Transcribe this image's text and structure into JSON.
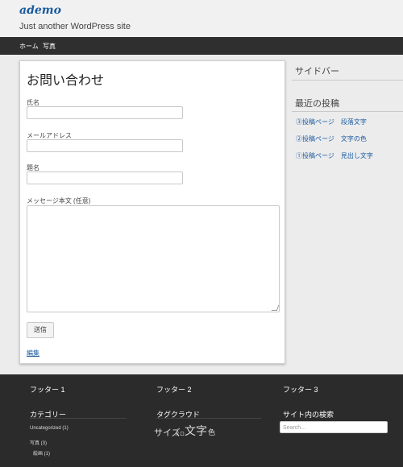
{
  "header": {
    "site_title": "ademo",
    "tagline": "Just another WordPress site"
  },
  "nav": {
    "items": [
      {
        "label": "ホーム"
      },
      {
        "label": "写真"
      }
    ]
  },
  "content": {
    "title": "お問い合わせ",
    "fields": {
      "name_label": "氏名",
      "email_label": "メールアドレス",
      "subject_label": "題名",
      "message_label": "メッセージ本文 (任意)"
    },
    "send_label": "送信",
    "edit_label": "編集"
  },
  "sidebar": {
    "title": "サイドバー",
    "recent_title": "最近の投稿",
    "recent_posts": [
      {
        "label": "③投稿ページ　段落文字"
      },
      {
        "label": "②投稿ページ　文字の色"
      },
      {
        "label": "①投稿ページ　見出し文字"
      }
    ]
  },
  "footer": {
    "titles": [
      "フッター 1",
      "フッター 2",
      "フッター 3"
    ],
    "categories_title": "カテゴリー",
    "categories": [
      {
        "label": "Uncategorized (1)"
      },
      {
        "label": "写真 (3)"
      },
      {
        "label": "絵画 (1)"
      }
    ],
    "tagcloud_title": "タグクラウド",
    "tags": [
      {
        "label": "サイズ"
      },
      {
        "label": "スロ"
      },
      {
        "label": "文字"
      },
      {
        "label": "色"
      }
    ],
    "search_title": "サイト内の検索",
    "search_placeholder": "Search..."
  }
}
